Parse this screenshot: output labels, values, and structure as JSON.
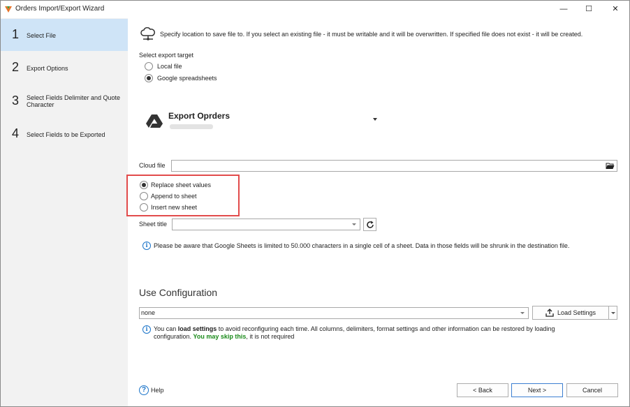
{
  "window": {
    "title": "Orders Import/Export Wizard",
    "minimize": "—",
    "maximize": "☐",
    "close": "✕"
  },
  "steps": [
    {
      "num": "1",
      "label": "Select File"
    },
    {
      "num": "2",
      "label": "Export Options"
    },
    {
      "num": "3",
      "label": "Select Fields Delimiter and Quote Character"
    },
    {
      "num": "4",
      "label": "Select Fields to be Exported"
    }
  ],
  "header": {
    "text": "Specify location to save file to. If you select an existing file - it must be writable and it will be overwritten. If specified file does not exist - it will be created."
  },
  "export_target": {
    "label": "Select export target",
    "options": [
      "Local file",
      "Google spreadsheets"
    ],
    "selected": "Google spreadsheets"
  },
  "account": {
    "name": "Export Oprders"
  },
  "cloud_file": {
    "label": "Cloud file",
    "value": ""
  },
  "sheet_mode": {
    "options": [
      "Replace sheet values",
      "Append to sheet",
      "Insert new sheet"
    ],
    "selected": "Replace sheet values"
  },
  "sheet_title": {
    "label": "Sheet title",
    "value": ""
  },
  "notice": {
    "text": "Please be aware that Google Sheets is limited to 50.000 characters in a single cell of a sheet. Data in those fields will be shrunk in the destination file."
  },
  "config": {
    "heading": "Use Configuration",
    "selected": "none",
    "load_button": "Load Settings",
    "info_part1": "You can ",
    "info_bold": "load settings",
    "info_part2": " to avoid reconfiguring each time. All columns, delimiters, format settings and other information can be restored by loading",
    "info_line2_part1": "configuration. ",
    "info_green": "You may skip this",
    "info_line2_part2": ", it is not required",
    "green_color": "#1a8a1a"
  },
  "footer": {
    "help": "Help",
    "back": "< Back",
    "next": "Next >",
    "cancel": "Cancel"
  },
  "colors": {
    "accent": "#cfe4f7",
    "highlight": "#e24b4b",
    "info": "#1b74c9"
  }
}
